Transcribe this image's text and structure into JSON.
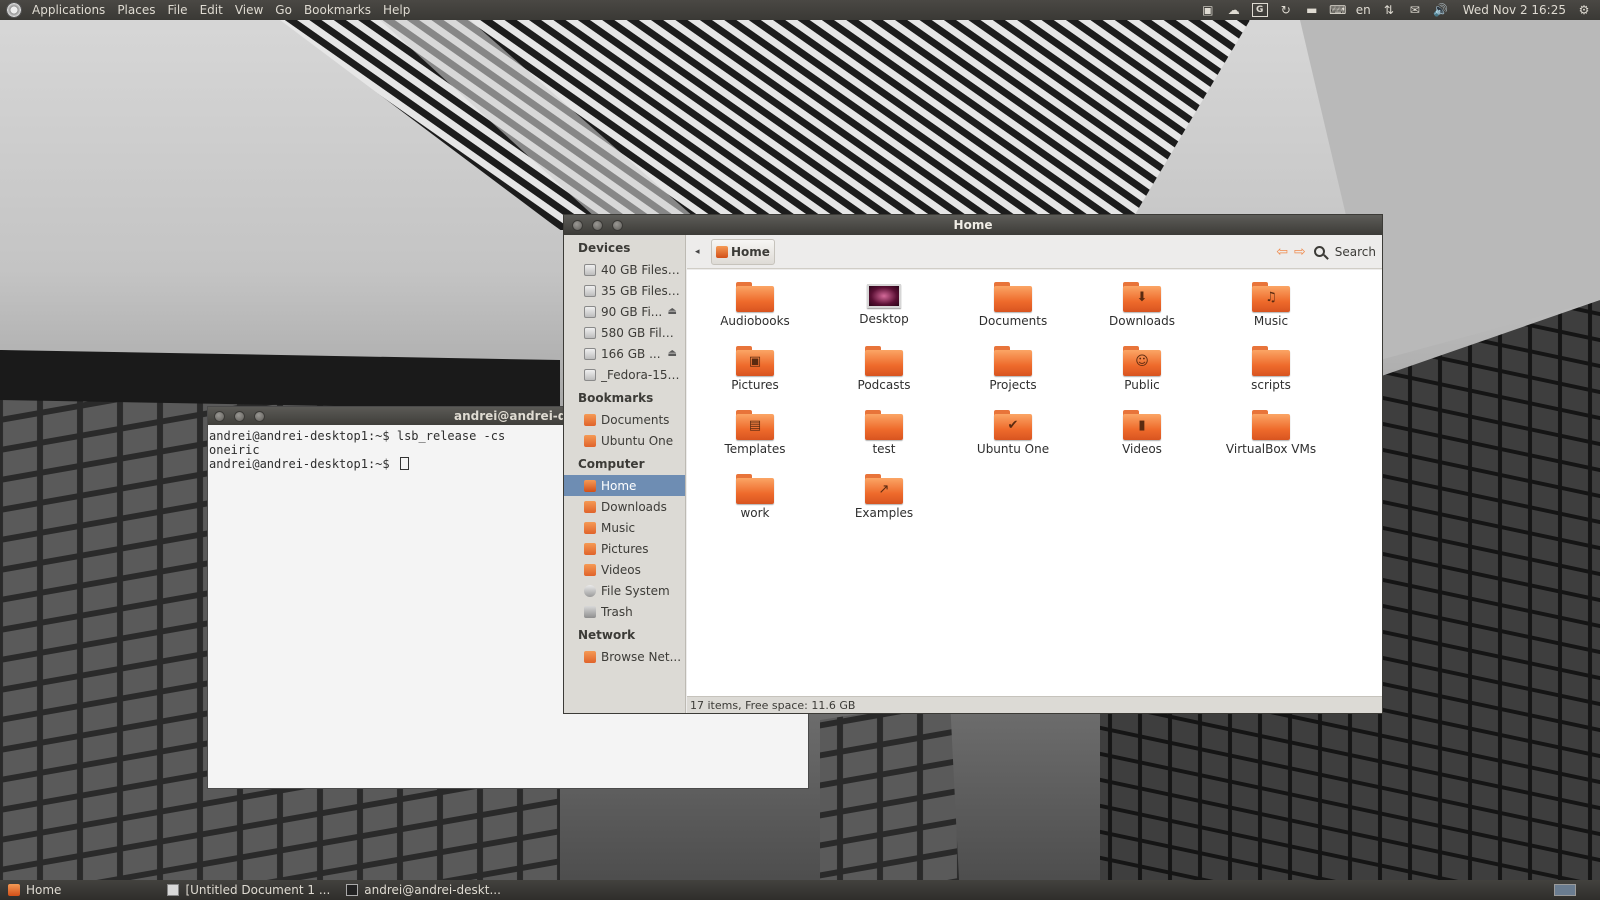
{
  "top_panel": {
    "menus": [
      "Applications",
      "Places",
      "File",
      "Edit",
      "View",
      "Go",
      "Bookmarks",
      "Help"
    ],
    "tray_icons": [
      "network-icon",
      "cloud-icon",
      "google-icon",
      "sync-icon",
      "battery-icon",
      "keyboard-icon",
      "transfer-icon",
      "mail-icon",
      "volume-icon",
      "gear-icon"
    ],
    "language": "en",
    "clock": "Wed Nov 2 16:25"
  },
  "terminal": {
    "title": "andrei@andrei-de",
    "lines": [
      "andrei@andrei-desktop1:~$ lsb_release -cs",
      "oneiric",
      "andrei@andrei-desktop1:~$ "
    ]
  },
  "nautilus": {
    "title": "Home",
    "breadcrumb": "Home",
    "search_label": "Search",
    "sidebar": {
      "devices_header": "Devices",
      "devices": [
        {
          "label": "40 GB Filesy...",
          "eject": false
        },
        {
          "label": "35 GB Filesy...",
          "eject": false
        },
        {
          "label": "90 GB Fi...",
          "eject": true
        },
        {
          "label": "580 GB Files...",
          "eject": false
        },
        {
          "label": "166 GB ...",
          "eject": true
        },
        {
          "label": "_Fedora-15-...",
          "eject": false
        }
      ],
      "bookmarks_header": "Bookmarks",
      "bookmarks": [
        "Documents",
        "Ubuntu One"
      ],
      "computer_header": "Computer",
      "computer": [
        "Home",
        "Downloads",
        "Music",
        "Pictures",
        "Videos",
        "File System",
        "Trash"
      ],
      "network_header": "Network",
      "network": [
        "Browse Net..."
      ]
    },
    "items": [
      {
        "label": "Audiobooks",
        "emblem": ""
      },
      {
        "label": "Desktop",
        "emblem": "desktop"
      },
      {
        "label": "Documents",
        "emblem": ""
      },
      {
        "label": "Downloads",
        "emblem": "⬇"
      },
      {
        "label": "Music",
        "emblem": "♫"
      },
      {
        "label": "Pictures",
        "emblem": "▣"
      },
      {
        "label": "Podcasts",
        "emblem": ""
      },
      {
        "label": "Projects",
        "emblem": ""
      },
      {
        "label": "Public",
        "emblem": "☺"
      },
      {
        "label": "scripts",
        "emblem": ""
      },
      {
        "label": "Templates",
        "emblem": "▤"
      },
      {
        "label": "test",
        "emblem": ""
      },
      {
        "label": "Ubuntu One",
        "emblem": "✔"
      },
      {
        "label": "Videos",
        "emblem": "▮"
      },
      {
        "label": "VirtualBox VMs",
        "emblem": ""
      },
      {
        "label": "work",
        "emblem": ""
      },
      {
        "label": "Examples",
        "emblem": "↗"
      }
    ],
    "status": "17 items, Free space: 11.6 GB"
  },
  "bottom_panel": {
    "tasks": [
      "Home",
      "[Untitled Document 1 ...",
      "andrei@andrei-deskt..."
    ]
  },
  "colors": {
    "folder_orange": "#ee6a2b",
    "selection_blue": "#6e8db3",
    "panel_dark": "#3c3b37"
  }
}
